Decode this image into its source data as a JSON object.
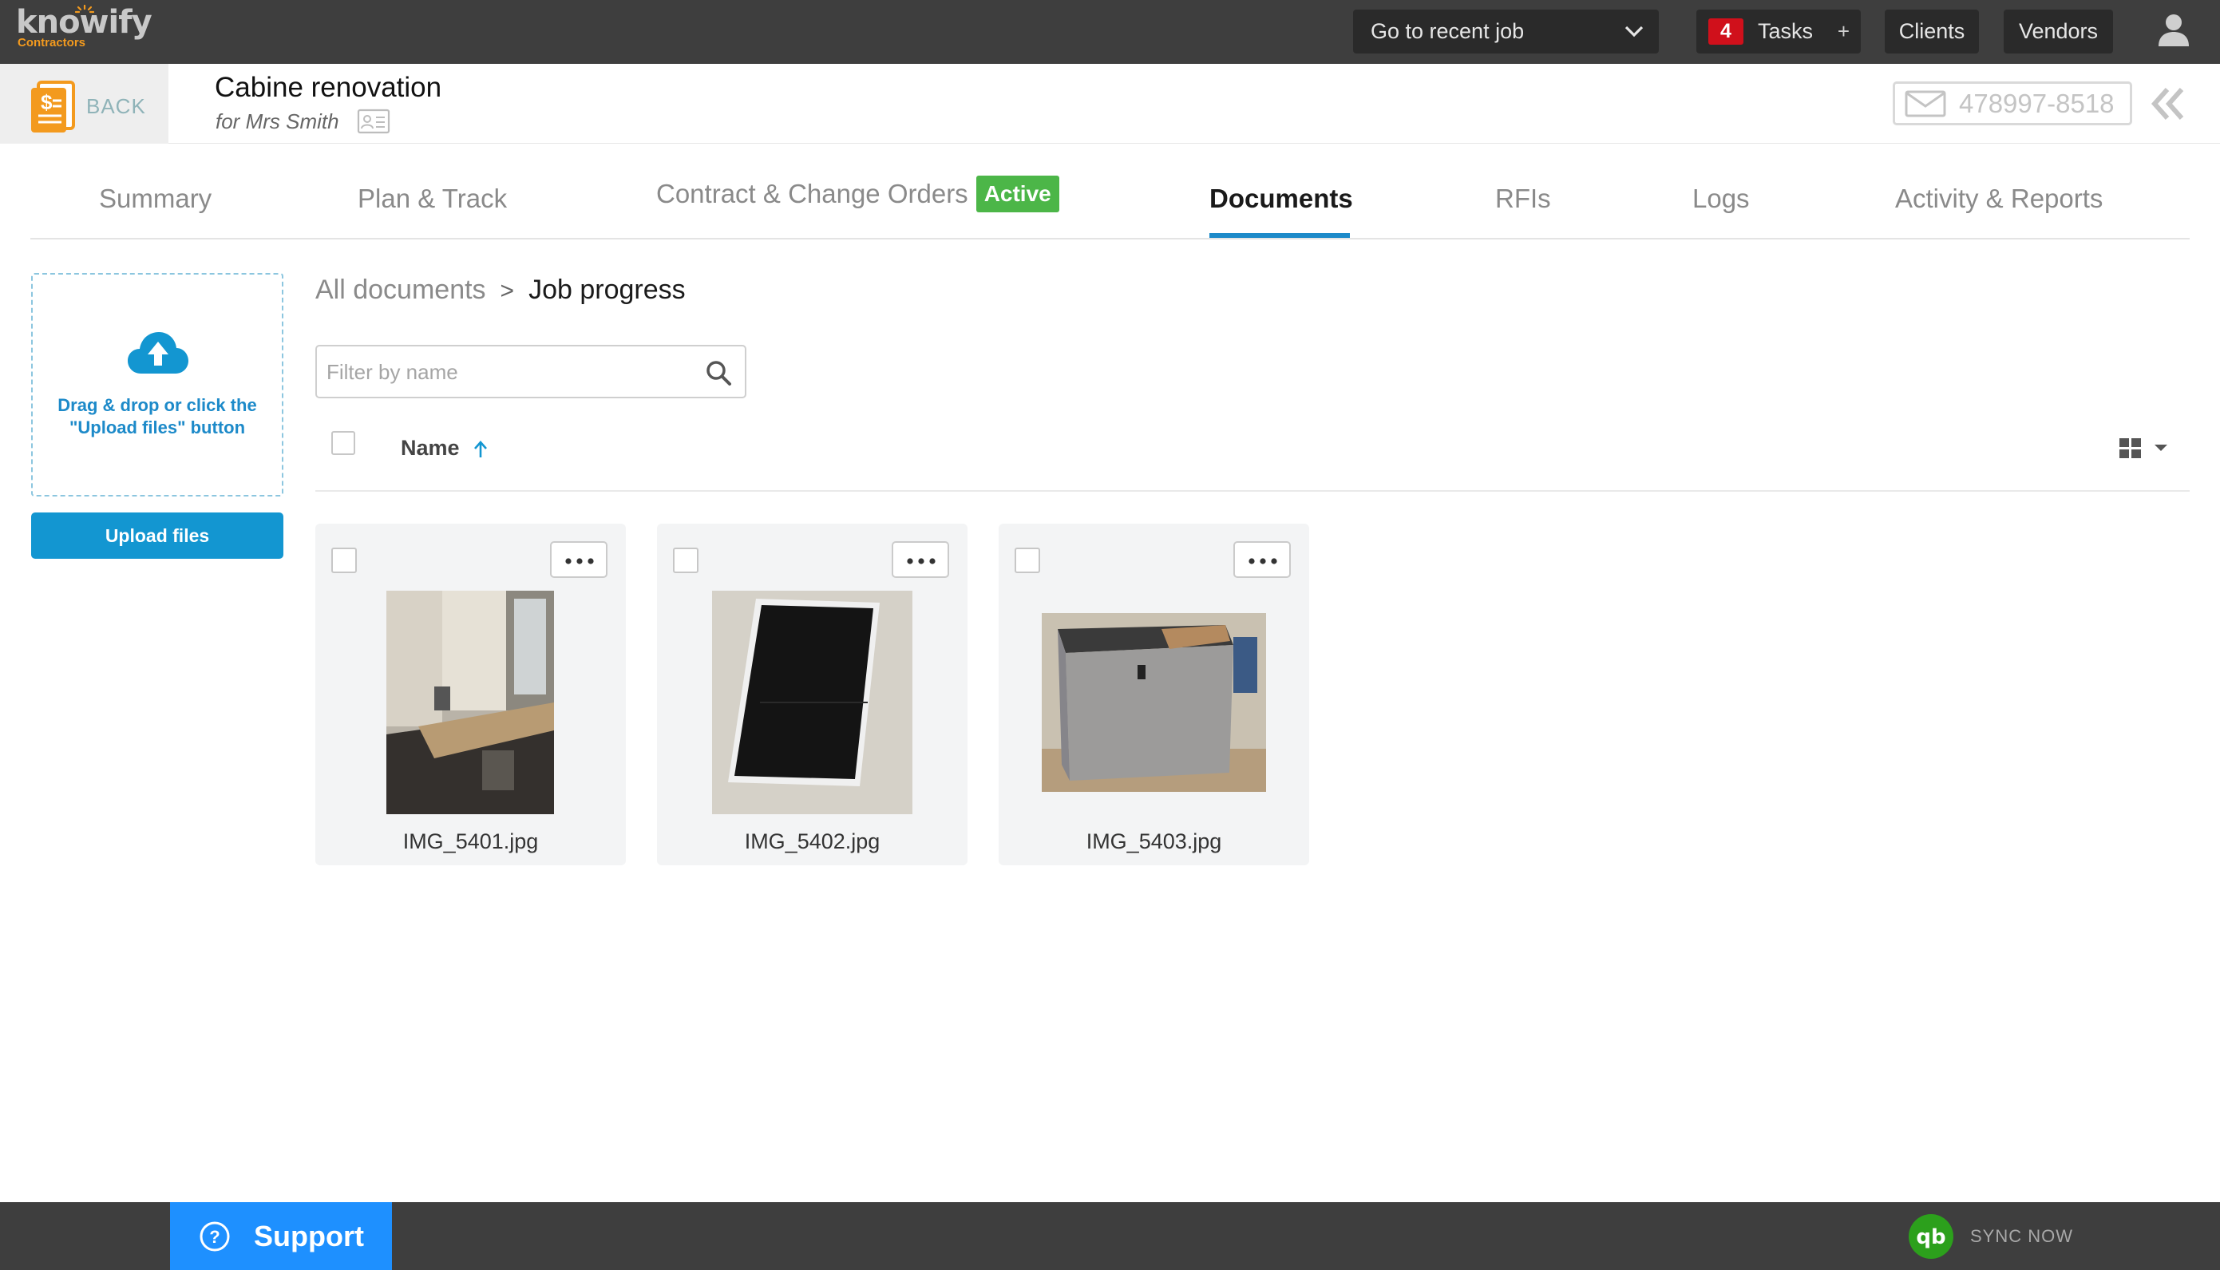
{
  "app": {
    "logo_text": "knowify",
    "logo_sub": "Contractors"
  },
  "topbar": {
    "recent_job_label": "Go to recent job",
    "tasks_count": "4",
    "tasks_label": "Tasks",
    "tasks_add": "+",
    "clients_label": "Clients",
    "vendors_label": "Vendors"
  },
  "job": {
    "back_label": "BACK",
    "title": "Cabine renovation",
    "client": "for Mrs Smith",
    "phone": "478997-8518"
  },
  "tabs": [
    {
      "label": "Summary"
    },
    {
      "label": "Plan & Track"
    },
    {
      "label": "Contract & Change Orders",
      "badge": "Active"
    },
    {
      "label": "Documents",
      "active": true
    },
    {
      "label": "RFIs"
    },
    {
      "label": "Logs"
    },
    {
      "label": "Activity & Reports"
    }
  ],
  "upload": {
    "dropzone_text": "Drag & drop or click the \"Upload files\" button",
    "button_label": "Upload files"
  },
  "breadcrumb": {
    "root": "All documents",
    "separator": ">",
    "current": "Job progress"
  },
  "filter": {
    "placeholder": "Filter by name",
    "value": ""
  },
  "list": {
    "name_header": "Name",
    "sort": "ascending"
  },
  "files": [
    {
      "name": "IMG_5401.jpg"
    },
    {
      "name": "IMG_5402.jpg"
    },
    {
      "name": "IMG_5403.jpg"
    }
  ],
  "footer": {
    "support_label": "Support",
    "sync_label": "SYNC NOW"
  },
  "colors": {
    "topbar": "#3e3e3e",
    "accent_blue": "#1396d1",
    "active_green": "#4cb648",
    "tasks_red": "#d0101b",
    "support_blue": "#1e90ff",
    "back_orange": "#f39a1e",
    "quickbooks_green": "#2ca01c"
  },
  "icons": {
    "user": "user-icon",
    "search": "search-icon",
    "upload": "cloud-upload-icon",
    "collapse": "double-chevron-left-icon",
    "view": "grid-view-icon",
    "quickbooks": "quickbooks-icon"
  }
}
